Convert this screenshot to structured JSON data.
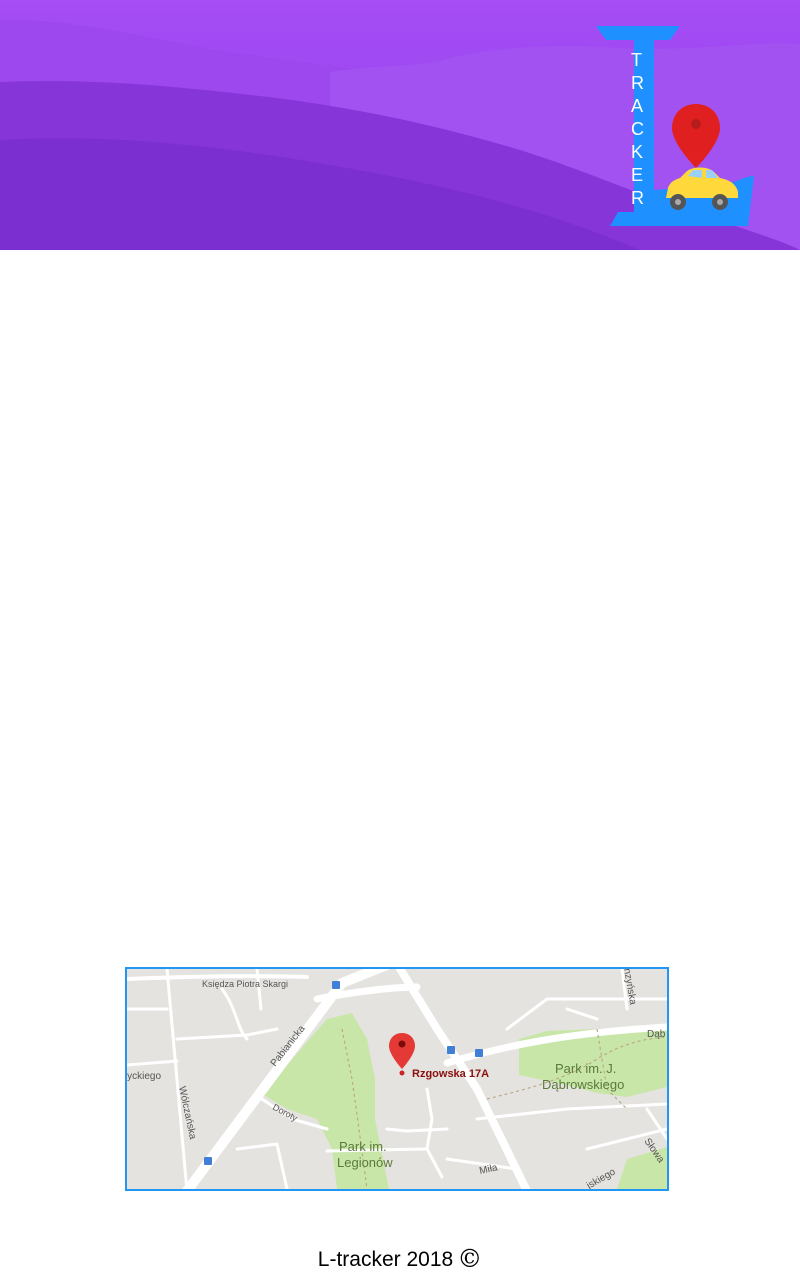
{
  "header": {
    "logo": {
      "letter": "L",
      "word": "TRACKER",
      "icons": [
        "map-pin-icon",
        "car-icon"
      ]
    }
  },
  "map": {
    "marker_label": "Rzgowska 17A",
    "street_labels": {
      "ksiedza": "Księdza Piotra Skargi",
      "pabianicka": "Pabianicka",
      "wolczanska": "Wólczańska",
      "zyckiego": "Życkiego",
      "doroty": "Doroty",
      "mila": "Miła",
      "dab": "Dąb",
      "nzynska": "nzyńska",
      "slowa": "Słowa",
      "jskiego": "jskiego"
    },
    "parks": {
      "legionow_1": "Park im.",
      "legionow_2": "Legionów",
      "dabrowskiego_1": "Park im. J.",
      "dabrowskiego_2": "Dąbrowskiego"
    },
    "colors": {
      "water_land": "#e5e3df",
      "road": "#ffffff",
      "park": "#c8e6a8",
      "marker": "#e53935",
      "border": "#2196f3"
    }
  },
  "footer": {
    "text": "L-tracker 2018",
    "copyright_symbol": "©"
  }
}
